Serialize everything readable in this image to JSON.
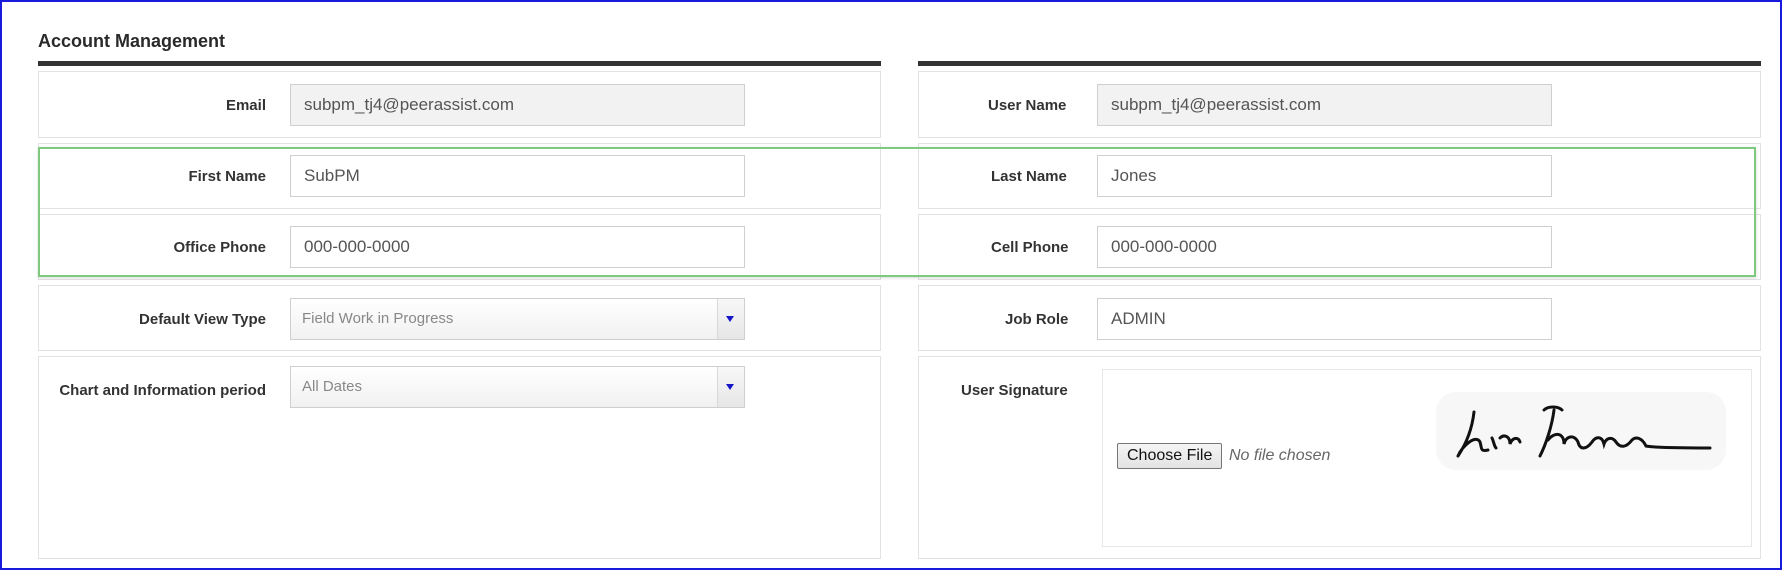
{
  "section": {
    "title": "Account Management"
  },
  "left": {
    "email": {
      "label": "Email",
      "value": "subpm_tj4@peerassist.com"
    },
    "first_name": {
      "label": "First Name",
      "value": "SubPM"
    },
    "office_phone": {
      "label": "Office Phone",
      "value": "000-000-0000"
    },
    "default_view": {
      "label": "Default View Type",
      "value": "Field Work in Progress"
    },
    "chart_period": {
      "label": "Chart and Information period",
      "value": "All Dates"
    }
  },
  "right": {
    "user_name": {
      "label": "User Name",
      "value": "subpm_tj4@peerassist.com"
    },
    "last_name": {
      "label": "Last Name",
      "value": "Jones"
    },
    "cell_phone": {
      "label": "Cell Phone",
      "value": "000-000-0000"
    },
    "job_role": {
      "label": "Job Role",
      "value": "ADMIN"
    },
    "signature": {
      "label": "User Signature",
      "choose_file_label": "Choose File",
      "no_file_text": "No file chosen"
    }
  },
  "colors": {
    "highlight": "#7dc97d",
    "frame": "#1a1adc",
    "select_arrow": "#1616c8"
  },
  "icons": {
    "select_arrow": "triangle-down-icon"
  }
}
